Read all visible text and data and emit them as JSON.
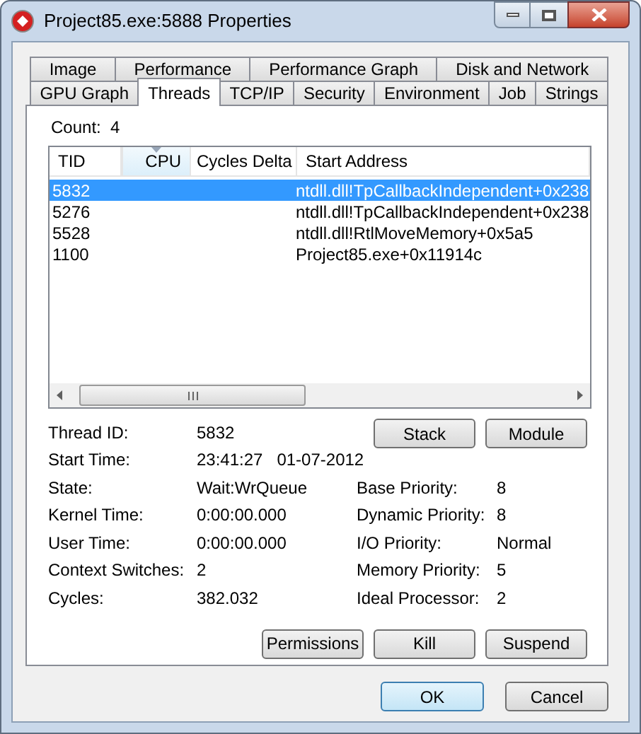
{
  "window": {
    "title": "Project85.exe:5888 Properties"
  },
  "tab_rows": [
    [
      {
        "label": "Image",
        "selected": false
      },
      {
        "label": "Performance",
        "selected": false
      },
      {
        "label": "Performance Graph",
        "selected": false
      },
      {
        "label": "Disk and Network",
        "selected": false
      }
    ],
    [
      {
        "label": "GPU Graph",
        "selected": false
      },
      {
        "label": "Threads",
        "selected": true
      },
      {
        "label": "TCP/IP",
        "selected": false
      },
      {
        "label": "Security",
        "selected": false
      },
      {
        "label": "Environment",
        "selected": false
      },
      {
        "label": "Job",
        "selected": false
      },
      {
        "label": "Strings",
        "selected": false
      }
    ]
  ],
  "count": {
    "label": "Count:",
    "value": "4"
  },
  "table": {
    "columns": [
      {
        "label": "TID",
        "sorted": false
      },
      {
        "label": "CPU",
        "sorted": true
      },
      {
        "label": "Cycles Delta",
        "sorted": false
      },
      {
        "label": "Start Address",
        "sorted": false
      }
    ],
    "rows": [
      {
        "tid": "5832",
        "start_address": "ntdll.dll!TpCallbackIndependent+0x238",
        "selected": true
      },
      {
        "tid": "5276",
        "start_address": "ntdll.dll!TpCallbackIndependent+0x238",
        "selected": false
      },
      {
        "tid": "5528",
        "start_address": "ntdll.dll!RtlMoveMemory+0x5a5",
        "selected": false
      },
      {
        "tid": "1100",
        "start_address": "Project85.exe+0x11914c",
        "selected": false
      }
    ]
  },
  "details_top": [
    {
      "label": "Thread ID:",
      "value": "5832"
    },
    {
      "label": "Start Time:",
      "value": "23:41:27   01-07-2012"
    }
  ],
  "top_buttons": [
    "Stack",
    "Module"
  ],
  "details": [
    {
      "label": "State:",
      "value": "Wait:WrQueue",
      "label_2": "Base Priority:",
      "value_2": "8"
    },
    {
      "label": "Kernel Time:",
      "value": "0:00:00.000",
      "label_2": "Dynamic Priority:",
      "value_2": "8"
    },
    {
      "label": "User Time:",
      "value": "0:00:00.000",
      "label_2": "I/O Priority:",
      "value_2": "Normal"
    },
    {
      "label": "Context Switches:",
      "value": "2",
      "label_2": "Memory Priority:",
      "value_2": "5"
    },
    {
      "label": "Cycles:",
      "value": "382.032",
      "label_2": "Ideal Processor:",
      "value_2": "2"
    }
  ],
  "action_buttons": [
    "Permissions",
    "Kill",
    "Suspend"
  ],
  "dialog_buttons": [
    {
      "label": "OK",
      "default": true
    },
    {
      "label": "Cancel",
      "default": false
    }
  ]
}
